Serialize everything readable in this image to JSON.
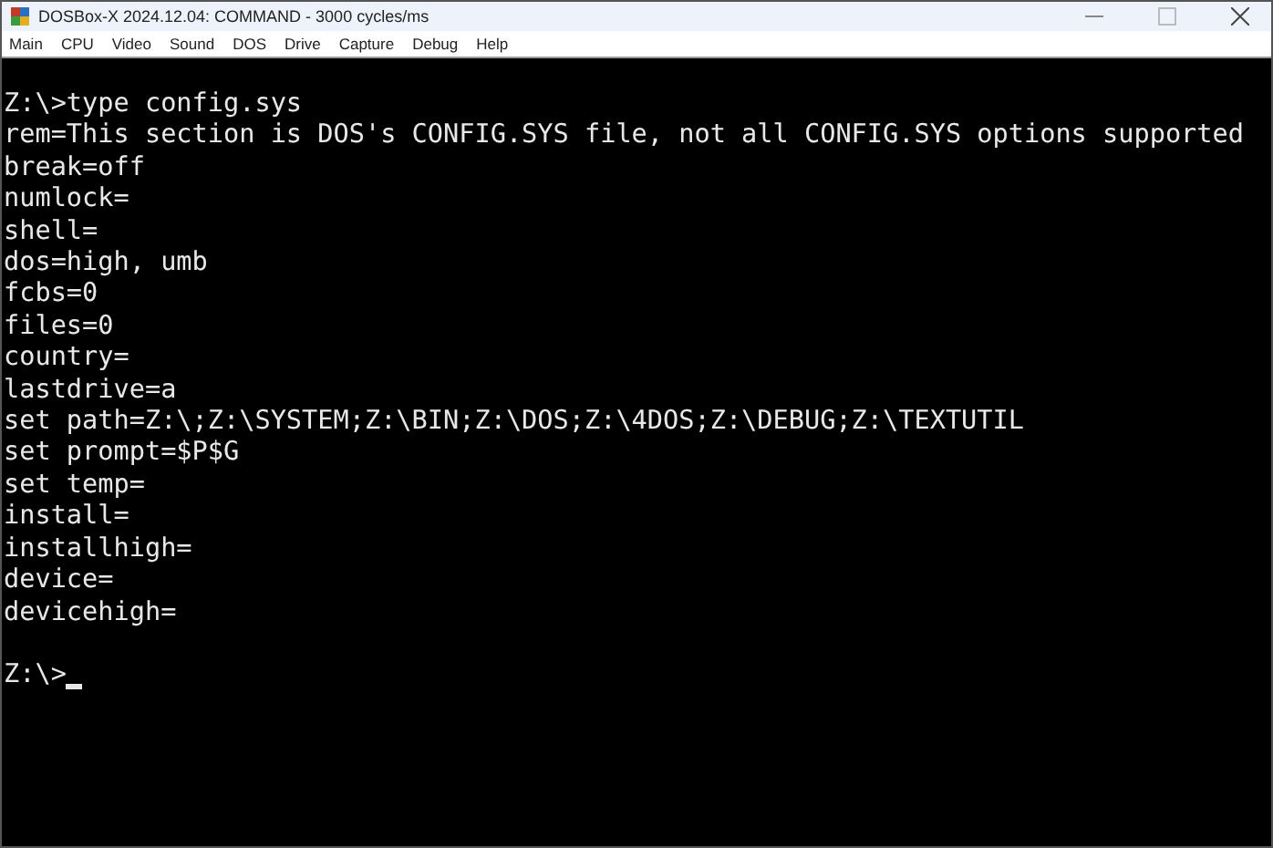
{
  "window": {
    "title": "DOSBox-X 2024.12.04: COMMAND - 3000 cycles/ms"
  },
  "menu": [
    "Main",
    "CPU",
    "Video",
    "Sound",
    "DOS",
    "Drive",
    "Capture",
    "Debug",
    "Help"
  ],
  "console": {
    "command_line": "Z:\\>type config.sys",
    "output": [
      "rem=This section is DOS's CONFIG.SYS file, not all CONFIG.SYS options supported",
      "break=off",
      "numlock=",
      "shell=",
      "dos=high, umb",
      "fcbs=0",
      "files=0",
      "country=",
      "lastdrive=a",
      "set path=Z:\\;Z:\\SYSTEM;Z:\\BIN;Z:\\DOS;Z:\\4DOS;Z:\\DEBUG;Z:\\TEXTUTIL",
      "set prompt=$P$G",
      "set temp=",
      "install=",
      "installhigh=",
      "device=",
      "devicehigh="
    ],
    "prompt": "Z:\\>"
  }
}
